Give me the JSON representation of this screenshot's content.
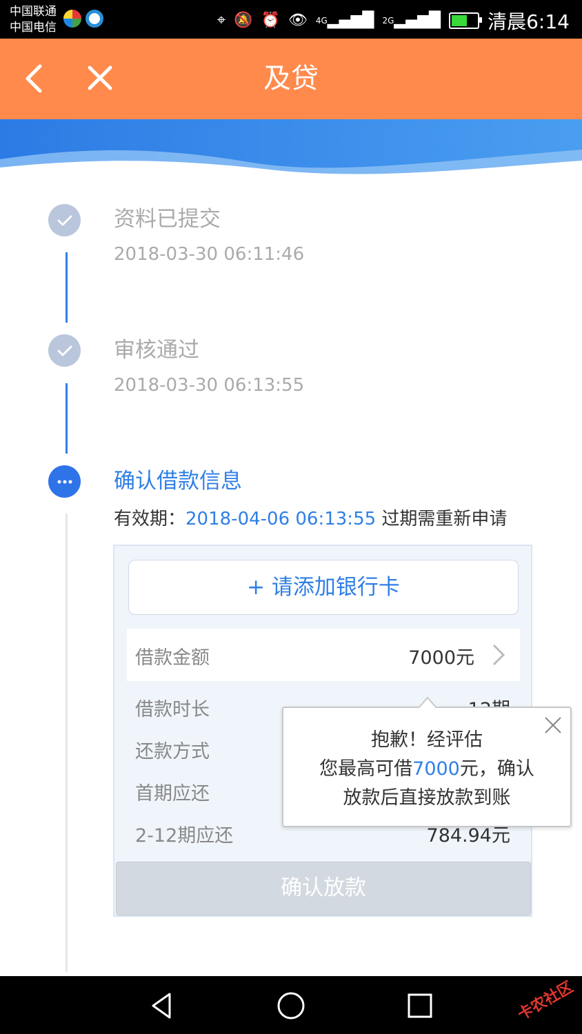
{
  "status_bar": {
    "carrier1": "中国联通",
    "carrier2": "中国电信",
    "signal1": "4G",
    "signal2": "2G",
    "time": "清晨6:14"
  },
  "header": {
    "title": "及贷"
  },
  "timeline": [
    {
      "title": "资料已提交",
      "time": "2018-03-30 06:11:46"
    },
    {
      "title": "审核通过",
      "time": "2018-03-30 06:13:55"
    },
    {
      "title": "确认借款信息"
    }
  ],
  "validity": {
    "prefix": "有效期：",
    "date": "2018-04-06 06:13:55",
    "suffix": " 过期需重新申请"
  },
  "card": {
    "add_bank_card": "+ 请添加银行卡",
    "amount_label": "借款金额",
    "amount_value": "7000元",
    "rows": [
      {
        "label": "借款时长",
        "value": "12期"
      },
      {
        "label": "还款方式",
        "value": ""
      },
      {
        "label": "首期应还",
        "value": ""
      },
      {
        "label": "2-12期应还",
        "value": "784.94元"
      }
    ],
    "confirm_button": "确认放款"
  },
  "popup": {
    "line1": "抱歉！经评估",
    "line2_prefix": "您最高可借",
    "line2_amount": "7000",
    "line2_suffix": "元，确认",
    "line3": "放款后直接放款到账"
  },
  "watermark": "卡农社区",
  "colors": {
    "header_bg": "#ff8a4c",
    "accent_blue": "#2f7fe6",
    "done_dot": "#b9c6dc"
  }
}
